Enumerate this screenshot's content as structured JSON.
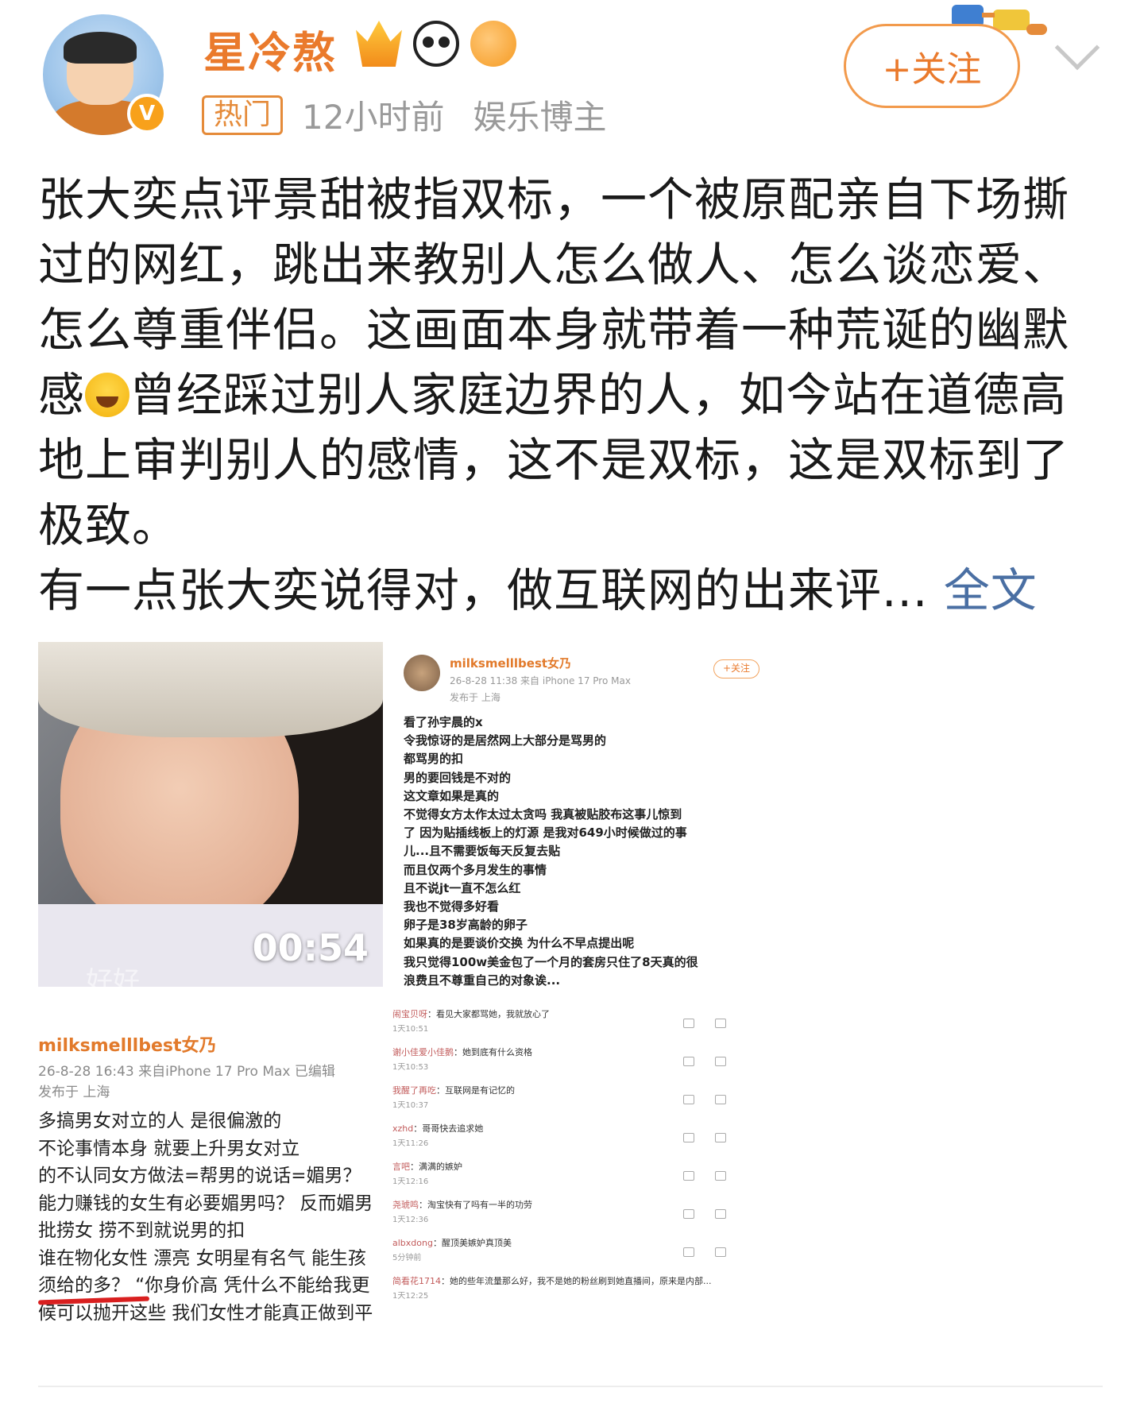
{
  "header": {
    "username": "星冷熬",
    "tag": "热门",
    "time": "12小时前",
    "role": "娱乐博主",
    "follow_label": "+关注"
  },
  "post": {
    "paragraph1_a": "张大奕点评景甜被指双标，一个被原配亲自下场撕过的网红，跳出来教别人怎么做人、怎么谈恋爱、怎么尊重伴侣。这画面本身就带着一种荒诞的幽默感",
    "paragraph1_b": "曾经踩过别人家庭边界的人，如今站在道德高地上审判别人的感情，这不是双标，这是双标到了极致。",
    "paragraph2": "有一点张大奕说得对，做互联网的出来评...",
    "more": "全文"
  },
  "video": {
    "duration": "00:54",
    "caption": "好好"
  },
  "shot1": {
    "name": "milksmelllbest女乃",
    "meta1": "26-8-28 11:38  来自 iPhone 17 Pro Max",
    "meta2": "发布于 上海",
    "follow": "+关注",
    "lines": [
      "看了孙宇晨的x",
      "令我惊讶的是居然网上大部分是骂男的",
      "都骂男的扣",
      "男的要回钱是不对的",
      "这文章如果是真的",
      "不觉得女方太作太过太贪吗  我真被贴胶布这事儿惊到",
      "了 因为贴插线板上的灯源 是我对649小时候做过的事",
      "儿...且不需要饭每天反复去贴",
      "而且仅两个多月发生的事情",
      "且不说jt一直不怎么红",
      "我也不觉得多好看",
      "卵子是38岁高龄的卵子",
      "如果真的是要谈价交换 为什么不早点提出呢",
      "我只觉得100w美金包了一个月的套房只住了8天真的很",
      "浪费且不尊重自己的对象诶..."
    ]
  },
  "shot2": {
    "name": "milksmelllbest女乃",
    "meta1": "26-8-28 16:43  来自iPhone 17 Pro Max  已编辑",
    "meta2": "发布于 上海",
    "lines": [
      "多搞男女对立的人 是很偏激的",
      "不论事情本身 就要上升男女对立",
      "的不认同女方做法=帮男的说话=媚男？",
      "能力赚钱的女生有必要媚男吗？ 反而媚男",
      "批捞女 捞不到就说男的扣",
      "谁在物化女性 漂亮 女明星有名气 能生孩",
      "须给的多？ “你身价高 凭什么不能给我更",
      "候可以抛开这些 我们女性才能真正做到平"
    ]
  },
  "comments": [
    {
      "user": "闹宝贝呀",
      "text": "：看见大家都骂她，我就放心了",
      "time": "1天10:51"
    },
    {
      "user": "谢小佳爱小佳鹅",
      "text": "：她到底有什么资格",
      "time": "1天10:53"
    },
    {
      "user": "我醒了再吃",
      "text": "：互联网是有记忆的",
      "time": "1天10:37"
    },
    {
      "user": "xzhd",
      "text": "：哥哥快去追求她",
      "time": "1天11:26"
    },
    {
      "user": "言吧",
      "text": "：满满的嫉妒",
      "time": "1天12:16"
    },
    {
      "user": "尧琥鸣",
      "text": "：淘宝快有了吗有一半的功劳",
      "time": "1天12:36"
    },
    {
      "user": "albxdong",
      "text": "：醒顶美嫉妒真顶美",
      "time": "5分钟前"
    },
    {
      "user": "简看花1714",
      "text": "：她的些年流量那么好，我不是她的粉丝刷到她直播间，原来是内部...",
      "time": "1天12:25"
    }
  ],
  "colors": {
    "accent": "#ea7a2c",
    "link": "#4a6fa3",
    "meta": "#9a9a9a"
  },
  "icons": [
    "verified-v-icon",
    "crown-badge-icon",
    "panda-badge-icon",
    "fish-badge-icon",
    "chevron-down-icon",
    "laugh-cry-emoji-icon"
  ]
}
